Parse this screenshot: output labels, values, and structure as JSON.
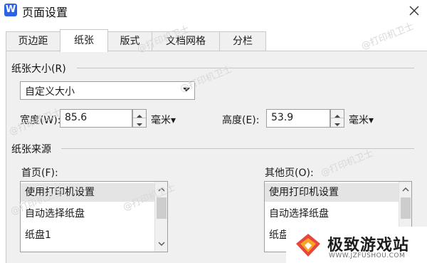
{
  "window": {
    "app_icon_letter": "W",
    "title": "页面设置",
    "close_label": "关闭"
  },
  "tabs": [
    {
      "label": "页边距",
      "active": false
    },
    {
      "label": "纸张",
      "active": true
    },
    {
      "label": "版式",
      "active": false
    },
    {
      "label": "文档网格",
      "active": false
    },
    {
      "label": "分栏",
      "active": false
    }
  ],
  "paper_size": {
    "section_label": "纸张大小(R)",
    "selected": "自定义大小",
    "width_label": "宽度(W):",
    "width_value": "85.6",
    "width_unit": "毫米▾",
    "height_label": "高度(E):",
    "height_value": "53.9",
    "height_unit": "毫米▾"
  },
  "paper_source": {
    "section_label": "纸张来源",
    "first_page": {
      "label": "首页(F):",
      "items": [
        "使用打印机设置",
        "自动选择纸盘",
        "纸盘1"
      ],
      "selected_index": 0
    },
    "other_pages": {
      "label": "其他页(O):",
      "items": [
        "使用打印机设置",
        "自动选择纸盘",
        "纸盘1"
      ],
      "selected_index": 0
    }
  },
  "watermarks": [
    "@打印机卫士",
    "@打印机卫士",
    "@打印机卫士",
    "@打印机卫士",
    "@打印机卫士",
    "@打印机卫士",
    "@打印机卫士"
  ],
  "brand": {
    "name": "极致游戏站",
    "url": "WWW.JZFUSHOU.COM"
  },
  "colors": {
    "app_icon": "#2b63e8",
    "panel": "#f0f0f0",
    "selection": "#e4e4e4",
    "brand_red": "#e8453c",
    "brand_orange": "#f6a623"
  }
}
